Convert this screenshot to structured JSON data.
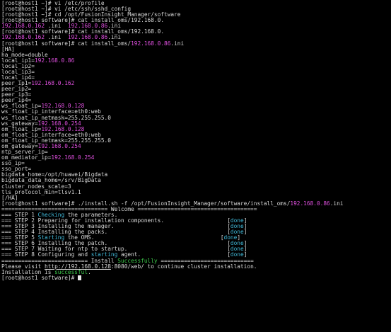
{
  "colors": {
    "background": "#000000",
    "text": "#d8d8d8",
    "ip_highlight": "#e050e0",
    "keyword_highlight": "#40b8d8",
    "success_highlight": "#3cc84a"
  },
  "terminal": {
    "lines": [
      [
        {
          "t": "[root@host1 ~]# vi /etc/profile"
        }
      ],
      [
        {
          "t": "[root@host1 ~]# vi /etc/ssh/sshd_config"
        }
      ],
      [
        {
          "t": "[root@host1 ~]# cd /opt/FusionInsight_Manager/software"
        }
      ],
      [
        {
          "t": "[root@host1 software]# cat install_oms/192.168.0."
        }
      ],
      [
        {
          "t": "192.168.0.162",
          "c": "magenta"
        },
        {
          "t": " .ini  "
        },
        {
          "t": "192.168.0.86",
          "c": "magenta"
        },
        {
          "t": ".ini"
        }
      ],
      [
        {
          "t": "[root@host1 software]# cat install_oms/192.168.0."
        }
      ],
      [
        {
          "t": "192.168.0.162",
          "c": "magenta"
        },
        {
          "t": " .ini  "
        },
        {
          "t": "192.168.0.86",
          "c": "magenta"
        },
        {
          "t": ".ini"
        }
      ],
      [
        {
          "t": "[root@host1 software]# cat install_oms/"
        },
        {
          "t": "192.168.0.86",
          "c": "magenta"
        },
        {
          "t": ".ini"
        }
      ],
      [
        {
          "t": "[HA]"
        }
      ],
      [
        {
          "t": "ha_mode=double"
        }
      ],
      [
        {
          "t": "local_ip1="
        },
        {
          "t": "192.168.0.86",
          "c": "magenta"
        }
      ],
      [
        {
          "t": "local_ip2="
        }
      ],
      [
        {
          "t": "local_ip3="
        }
      ],
      [
        {
          "t": "local_ip4="
        }
      ],
      [
        {
          "t": "peer_ip1="
        },
        {
          "t": "192.168.0.162",
          "c": "magenta"
        }
      ],
      [
        {
          "t": "peer_ip2="
        }
      ],
      [
        {
          "t": "peer_ip3="
        }
      ],
      [
        {
          "t": "peer_ip4="
        }
      ],
      [
        {
          "t": "ws_float_ip="
        },
        {
          "t": "192.168.0.128",
          "c": "magenta"
        }
      ],
      [
        {
          "t": "ws_float_ip_interface=eth0:web"
        }
      ],
      [
        {
          "t": "ws_float_ip_netmask=255.255.255.0"
        }
      ],
      [
        {
          "t": "ws_gateway="
        },
        {
          "t": "192.168.0.254",
          "c": "magenta"
        }
      ],
      [
        {
          "t": "om_float_ip="
        },
        {
          "t": "192.168.0.128",
          "c": "magenta"
        }
      ],
      [
        {
          "t": "om_float_ip_interface=eth0:web"
        }
      ],
      [
        {
          "t": "om_float_ip_netmask=255.255.255.0"
        }
      ],
      [
        {
          "t": "om_gateway="
        },
        {
          "t": "192.168.0.254",
          "c": "magenta"
        }
      ],
      [
        {
          "t": "ntp_server_ip="
        }
      ],
      [
        {
          "t": "om_mediator_ip="
        },
        {
          "t": "192.168.0.254",
          "c": "magenta"
        }
      ],
      [
        {
          "t": "sso_ip="
        }
      ],
      [
        {
          "t": "sso_port="
        }
      ],
      [
        {
          "t": "bigdata_home=/opt/huawei/Bigdata"
        }
      ],
      [
        {
          "t": "bigdata_data_home=/srv/BigData"
        }
      ],
      [
        {
          "t": "cluster_nodes_scale=3"
        }
      ],
      [
        {
          "t": "tls_protocol_min=tlsv1.1"
        }
      ],
      [
        {
          "t": "[/HA]"
        }
      ],
      [
        {
          "t": "[root@host1 software]# ./install.sh -f /opt/FusionInsight_Manager/software/install_oms/"
        },
        {
          "t": "192.168.0.86",
          "c": "magenta"
        },
        {
          "t": ".ini"
        }
      ],
      [
        {
          "t": "================================ Welcome ===================================="
        }
      ],
      [
        {
          "t": "=== STEP 1 "
        },
        {
          "t": "Checking",
          "c": "cyan"
        },
        {
          "t": " the parameters."
        }
      ],
      [
        {
          "t": "=== STEP 2 Preparing for installation components.                   "
        },
        {
          "t": "[",
          "c": "default"
        },
        {
          "t": "done",
          "c": "cyan"
        },
        {
          "t": "]"
        }
      ],
      [
        {
          "t": "=== STEP 3 Installing the manager.                                  "
        },
        {
          "t": "["
        },
        {
          "t": "done",
          "c": "cyan"
        },
        {
          "t": "]"
        }
      ],
      [
        {
          "t": "=== STEP 4 Installing the packs.                                    "
        },
        {
          "t": "["
        },
        {
          "t": "done",
          "c": "cyan"
        },
        {
          "t": "]"
        }
      ],
      [
        {
          "t": "=== STEP 5 "
        },
        {
          "t": "Starting",
          "c": "cyan"
        },
        {
          "t": " the OMS.                                      "
        },
        {
          "t": "["
        },
        {
          "t": "done",
          "c": "cyan"
        },
        {
          "t": "]"
        }
      ],
      [
        {
          "t": "=== STEP 6 Installing the patch.                                    "
        },
        {
          "t": "["
        },
        {
          "t": "done",
          "c": "cyan"
        },
        {
          "t": "]"
        }
      ],
      [
        {
          "t": "=== STEP 7 Waiting for ntp to startup.                              "
        },
        {
          "t": "["
        },
        {
          "t": "done",
          "c": "cyan"
        },
        {
          "t": "]"
        }
      ],
      [
        {
          "t": "=== STEP 8 Configuring and "
        },
        {
          "t": "starting",
          "c": "cyan"
        },
        {
          "t": " agent.                          "
        },
        {
          "t": "["
        },
        {
          "t": "done",
          "c": "cyan"
        },
        {
          "t": "]"
        }
      ],
      [
        {
          "t": "========================== Install "
        },
        {
          "t": "Successfully",
          "c": "green"
        },
        {
          "t": " ============================"
        }
      ],
      [
        {
          "t": "Please visit "
        },
        {
          "t": "http://192.168.0.128",
          "c": "link"
        },
        {
          "t": ":8080/web/ to continue cluster installation."
        }
      ],
      [
        {
          "t": "Installation is "
        },
        {
          "t": "successful",
          "c": "green"
        },
        {
          "t": "."
        }
      ],
      [
        {
          "t": "[root@host1 software]# "
        }
      ]
    ]
  }
}
